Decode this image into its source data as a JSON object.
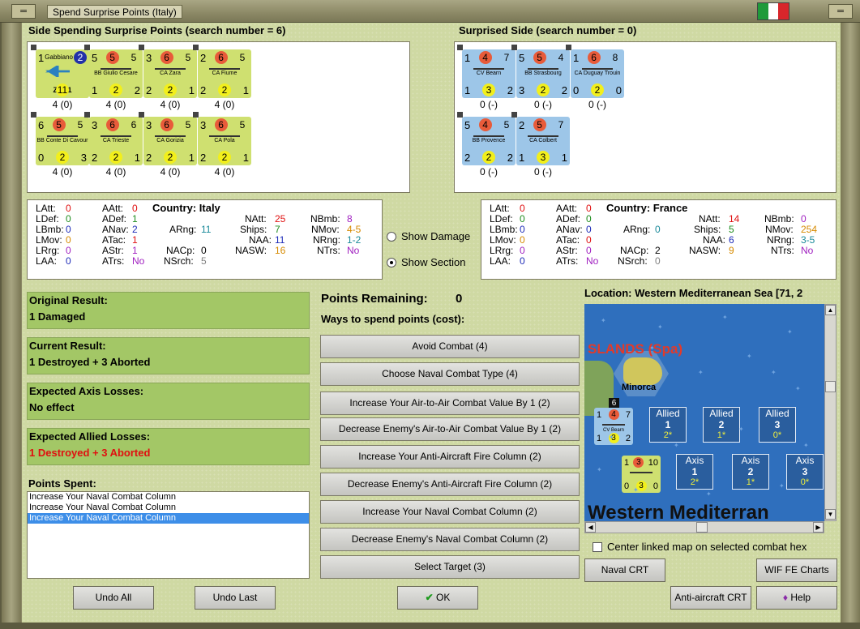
{
  "window": {
    "title": "Spend Surprise Points (Italy)",
    "flag_colors": [
      "#1f9a3a",
      "#ffffff",
      "#d8262b"
    ]
  },
  "left_side": {
    "heading": "Side Spending Surprise Points (search number = 6)",
    "units": [
      {
        "tl": "1",
        "tm": "Gabbiano",
        "tr": "2",
        "name": "Z.501",
        "bl": "",
        "bm": "11",
        "br": "",
        "label": "4 (0)",
        "type": "air"
      },
      {
        "tl": "5",
        "tm": "5",
        "tr": "5",
        "name": "BB Giulio Cesare",
        "bl": "1",
        "bm": "2",
        "br": "2",
        "label": "4 (0)",
        "type": "ship"
      },
      {
        "tl": "3",
        "tm": "6",
        "tr": "5",
        "name": "CA Zara",
        "bl": "2",
        "bm": "2",
        "br": "1",
        "label": "4 (0)",
        "type": "ship"
      },
      {
        "tl": "2",
        "tm": "6",
        "tr": "5",
        "name": "CA Fiume",
        "bl": "2",
        "bm": "2",
        "br": "1",
        "label": "4 (0)",
        "type": "ship"
      },
      {
        "tl": "6",
        "tm": "5",
        "tr": "5",
        "name": "BB Conte Di Cavour",
        "bl": "0",
        "bm": "2",
        "br": "3",
        "label": "4 (0)",
        "type": "ship"
      },
      {
        "tl": "3",
        "tm": "6",
        "tr": "6",
        "name": "CA Trieste",
        "bl": "2",
        "bm": "2",
        "br": "1",
        "label": "4 (0)",
        "type": "ship"
      },
      {
        "tl": "3",
        "tm": "6",
        "tr": "5",
        "name": "CA Gorizia",
        "bl": "2",
        "bm": "2",
        "br": "1",
        "label": "4 (0)",
        "type": "ship"
      },
      {
        "tl": "3",
        "tm": "6",
        "tr": "5",
        "name": "CA Pola",
        "bl": "2",
        "bm": "2",
        "br": "1",
        "label": "4 (0)",
        "type": "ship"
      }
    ]
  },
  "right_side": {
    "heading": "Surprised Side (search number = 0)",
    "units": [
      {
        "tl": "1",
        "tm": "4",
        "tr": "7",
        "name": "CV Bearn",
        "bl": "1",
        "bm": "3",
        "br": "2",
        "label": "0 (-)",
        "type": "ship"
      },
      {
        "tl": "5",
        "tm": "5",
        "tr": "4",
        "name": "BB Strasbourg",
        "bl": "3",
        "bm": "2",
        "br": "2",
        "label": "0 (-)",
        "type": "ship"
      },
      {
        "tl": "1",
        "tm": "6",
        "tr": "8",
        "name": "CA Duguay Trouin",
        "bl": "0",
        "bm": "2",
        "br": "0",
        "label": "0 (-)",
        "type": "ship"
      },
      {
        "tl": "5",
        "tm": "4",
        "tr": "5",
        "name": "BB Provence",
        "bl": "2",
        "bm": "2",
        "br": "2",
        "label": "0 (-)",
        "type": "ship"
      },
      {
        "tl": "2",
        "tm": "5",
        "tr": "7",
        "name": "CA Colbert",
        "bl": "1",
        "bm": "3",
        "br": "1",
        "label": "0 (-)",
        "type": "ship"
      }
    ]
  },
  "italy_stats": {
    "country_label": "Country: Italy",
    "latt_l": "LAtt:",
    "latt_v": "0",
    "ldef_l": "LDef:",
    "ldef_v": "0",
    "lbmb_l": "LBmb:",
    "lbmb_v": "0",
    "lmov_l": "LMov:",
    "lmov_v": "0",
    "lrrg_l": "LRrg:",
    "lrrg_v": "0",
    "laa_l": "LAA:",
    "laa_v": "0",
    "aatt_l": "AAtt:",
    "aatt_v": "0",
    "adef_l": "ADef:",
    "adef_v": "1",
    "anav_l": "ANav:",
    "anav_v": "2",
    "atac_l": "ATac:",
    "atac_v": "1",
    "astr_l": "AStr:",
    "astr_v": "1",
    "atrs_l": "ATrs:",
    "atrs_v": "No",
    "arng_l": "ARng:",
    "arng_v": "11",
    "nacp_l": "NACp:",
    "nacp_v": "0",
    "nsrch_l": "NSrch:",
    "nsrch_v": "5",
    "natt_l": "NAtt:",
    "natt_v": "25",
    "ships_l": "Ships:",
    "ships_v": "7",
    "naa_l": "NAA:",
    "naa_v": "11",
    "nasw_l": "NASW:",
    "nasw_v": "16",
    "nbmb_l": "NBmb:",
    "nbmb_v": "8",
    "nmov_l": "NMov:",
    "nmov_v": "4-5",
    "nrng_l": "NRng:",
    "nrng_v": "1-2",
    "ntrs_l": "NTrs:",
    "ntrs_v": "No"
  },
  "france_stats": {
    "country_label": "Country: France",
    "latt_l": "LAtt:",
    "latt_v": "0",
    "ldef_l": "LDef:",
    "ldef_v": "0",
    "lbmb_l": "LBmb:",
    "lbmb_v": "0",
    "lmov_l": "LMov:",
    "lmov_v": "0",
    "lrrg_l": "LRrg:",
    "lrrg_v": "0",
    "laa_l": "LAA:",
    "laa_v": "0",
    "aatt_l": "AAtt:",
    "aatt_v": "0",
    "adef_l": "ADef:",
    "adef_v": "0",
    "anav_l": "ANav:",
    "anav_v": "0",
    "atac_l": "ATac:",
    "atac_v": "0",
    "astr_l": "AStr:",
    "astr_v": "0",
    "atrs_l": "ATrs:",
    "atrs_v": "No",
    "arng_l": "ARng:",
    "arng_v": "0",
    "nacp_l": "NACp:",
    "nacp_v": "2",
    "nsrch_l": "NSrch:",
    "nsrch_v": "0",
    "natt_l": "NAtt:",
    "natt_v": "14",
    "ships_l": "Ships:",
    "ships_v": "5",
    "naa_l": "NAA:",
    "naa_v": "6",
    "nasw_l": "NASW:",
    "nasw_v": "9",
    "nbmb_l": "NBmb:",
    "nbmb_v": "0",
    "nmov_l": "NMov:",
    "nmov_v": "254",
    "nrng_l": "NRng:",
    "nrng_v": "3-5",
    "ntrs_l": "NTrs:",
    "ntrs_v": "No"
  },
  "view_options": {
    "show_damage": "Show Damage",
    "show_section": "Show Section",
    "selected": "show_section"
  },
  "results": {
    "original_label": "Original Result:",
    "original_value": "1 Damaged",
    "current_label": "Current Result:",
    "current_value": "1 Destroyed + 3 Aborted",
    "axis_label": "Expected Axis Losses:",
    "axis_value": "No effect",
    "allied_label": "Expected Allied Losses:",
    "allied_value": "1 Destroyed + 3 Aborted"
  },
  "points_spent": {
    "label": "Points Spent:",
    "items": [
      "Increase Your Naval Combat Column",
      "Increase Your Naval Combat Column",
      "Increase Your Naval Combat Column"
    ],
    "selected_index": 2
  },
  "spending": {
    "remaining_label": "Points Remaining:",
    "remaining_value": "0",
    "ways_label": "Ways to spend points (cost):",
    "options": [
      "Avoid Combat (4)",
      "Choose Naval Combat Type (4)",
      "Increase Your Air-to-Air Combat Value By 1 (2)",
      "Decrease Enemy's Air-to-Air Combat Value By 1 (2)",
      "Increase Your Anti-Aircraft Fire Column (2)",
      "Decrease Enemy's Anti-Aircraft Fire Column (2)",
      "Increase Your Naval Combat Column (2)",
      "Decrease Enemy's Naval Combat Column (2)",
      "Select Target (3)"
    ]
  },
  "map": {
    "location_label": "Location: Western Mediterranean Sea [71, 2",
    "islands_label": "SLANDS (Spa)",
    "minorca_label": "Minorca",
    "sea_label": "Western Mediterran",
    "stack_count": "6",
    "french_counter": {
      "tl": "1",
      "tm": "4",
      "tr": "7",
      "name": "CV Bearn",
      "bl": "1",
      "bm": "3",
      "br": "2"
    },
    "italian_counter": {
      "tl": "1",
      "tm": "3",
      "tr": "10",
      "bl": "0",
      "bm": "3",
      "br": "0"
    },
    "allied_boxes": [
      {
        "side": "Allied",
        "num": "1",
        "val": "2*"
      },
      {
        "side": "Allied",
        "num": "2",
        "val": "1*"
      },
      {
        "side": "Allied",
        "num": "3",
        "val": "0*"
      }
    ],
    "axis_boxes": [
      {
        "side": "Axis",
        "num": "1",
        "val": "2*"
      },
      {
        "side": "Axis",
        "num": "2",
        "val": "1*"
      },
      {
        "side": "Axis",
        "num": "3",
        "val": "0*"
      }
    ],
    "center_label": "Center linked map on selected combat hex"
  },
  "buttons": {
    "undo_all": "Undo All",
    "undo_last": "Undo Last",
    "ok": "OK",
    "naval_crt": "Naval CRT",
    "wif_fe_charts": "WIF FE Charts",
    "anti_aircraft_crt": "Anti-aircraft CRT",
    "help": "Help"
  }
}
